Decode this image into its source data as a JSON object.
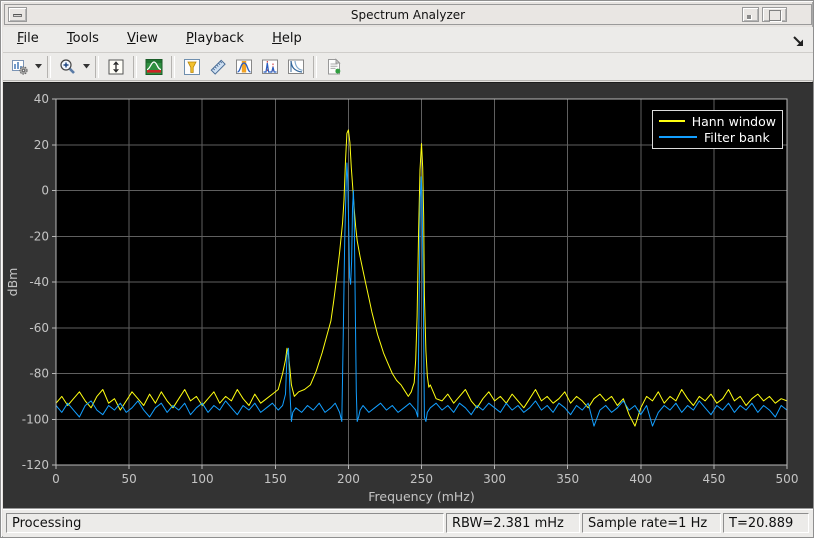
{
  "window": {
    "title": "Spectrum Analyzer"
  },
  "menu": {
    "items": [
      {
        "label": "File"
      },
      {
        "label": "Tools"
      },
      {
        "label": "View"
      },
      {
        "label": "Playback"
      },
      {
        "label": "Help"
      }
    ]
  },
  "toolbar": {
    "icons": [
      "configuration",
      "zoom-in",
      "autoscale-y",
      "spectrum-settings",
      "peak-finder",
      "cursor-measurements",
      "channel-measurements",
      "distortion-measurements",
      "spectral-mask",
      "generate-script"
    ]
  },
  "statusbar": {
    "state": "Processing",
    "rbw": "RBW=2.381 mHz",
    "sample_rate": "Sample rate=1 Hz",
    "time": "T=20.889"
  },
  "colors": {
    "trace_yellow": "#FFFF11",
    "trace_blue": "#139FFF",
    "plot_background": "#000000",
    "panel_background": "#333333",
    "grid": "#5f5f5f",
    "axis": "#b8b8b8",
    "tick_label": "#c4c4c4"
  },
  "chart_data": {
    "type": "line",
    "title": "",
    "xlabel": "Frequency (mHz)",
    "ylabel": "dBm",
    "xlim": [
      0,
      500
    ],
    "ylim": [
      -120,
      40
    ],
    "xticks": [
      0,
      50,
      100,
      150,
      200,
      250,
      300,
      350,
      400,
      450,
      500
    ],
    "yticks": [
      40,
      20,
      0,
      -20,
      -40,
      -60,
      -80,
      -100,
      -120
    ],
    "grid": true,
    "legend_position": "top-right",
    "series": [
      {
        "name": "Hann window",
        "color": "#FFFF11",
        "points": [
          [
            0,
            -93
          ],
          [
            4,
            -90
          ],
          [
            8,
            -94
          ],
          [
            12,
            -91
          ],
          [
            16,
            -88
          ],
          [
            20,
            -92
          ],
          [
            24,
            -95
          ],
          [
            28,
            -90
          ],
          [
            32,
            -87
          ],
          [
            36,
            -93
          ],
          [
            40,
            -91
          ],
          [
            44,
            -96
          ],
          [
            48,
            -92
          ],
          [
            52,
            -88
          ],
          [
            56,
            -91
          ],
          [
            60,
            -94
          ],
          [
            64,
            -89
          ],
          [
            68,
            -93
          ],
          [
            72,
            -88
          ],
          [
            76,
            -92
          ],
          [
            80,
            -95
          ],
          [
            84,
            -91
          ],
          [
            88,
            -87
          ],
          [
            92,
            -92
          ],
          [
            96,
            -90
          ],
          [
            100,
            -94
          ],
          [
            104,
            -91
          ],
          [
            108,
            -88
          ],
          [
            112,
            -93
          ],
          [
            116,
            -90
          ],
          [
            120,
            -92
          ],
          [
            124,
            -87
          ],
          [
            128,
            -91
          ],
          [
            132,
            -94
          ],
          [
            136,
            -89
          ],
          [
            140,
            -93
          ],
          [
            144,
            -91
          ],
          [
            148,
            -89
          ],
          [
            152,
            -87
          ],
          [
            155,
            -80
          ],
          [
            157,
            -74
          ],
          [
            158,
            -69
          ],
          [
            159,
            -72
          ],
          [
            160,
            -78
          ],
          [
            161,
            -85
          ],
          [
            163,
            -90
          ],
          [
            166,
            -88
          ],
          [
            170,
            -87
          ],
          [
            174,
            -85
          ],
          [
            178,
            -79
          ],
          [
            182,
            -71
          ],
          [
            185,
            -64
          ],
          [
            188,
            -57
          ],
          [
            190,
            -48
          ],
          [
            192,
            -38
          ],
          [
            194,
            -27
          ],
          [
            196,
            -14
          ],
          [
            197,
            -4
          ],
          [
            198,
            13
          ],
          [
            199,
            25
          ],
          [
            200,
            26.5
          ],
          [
            201,
            21
          ],
          [
            202,
            10
          ],
          [
            203,
            1
          ],
          [
            204,
            -8
          ],
          [
            205,
            -16
          ],
          [
            206,
            -22
          ],
          [
            208,
            -29
          ],
          [
            210,
            -35
          ],
          [
            212,
            -41
          ],
          [
            214,
            -47
          ],
          [
            216,
            -53
          ],
          [
            218,
            -58
          ],
          [
            220,
            -63
          ],
          [
            222,
            -67
          ],
          [
            224,
            -71
          ],
          [
            226,
            -74
          ],
          [
            228,
            -77
          ],
          [
            230,
            -80
          ],
          [
            233,
            -83
          ],
          [
            236,
            -85
          ],
          [
            239,
            -88
          ],
          [
            241,
            -90
          ],
          [
            243,
            -88
          ],
          [
            244,
            -86
          ],
          [
            245,
            -84
          ],
          [
            246,
            -74
          ],
          [
            247,
            -55
          ],
          [
            248,
            -18
          ],
          [
            249,
            9
          ],
          [
            250,
            20.5
          ],
          [
            250.8,
            10
          ],
          [
            251.5,
            -12
          ],
          [
            252,
            -46
          ],
          [
            253,
            -70
          ],
          [
            254,
            -81
          ],
          [
            255,
            -86
          ],
          [
            256,
            -85
          ],
          [
            258,
            -88
          ],
          [
            260,
            -91
          ],
          [
            264,
            -92
          ],
          [
            268,
            -89
          ],
          [
            272,
            -93
          ],
          [
            276,
            -90
          ],
          [
            280,
            -87
          ],
          [
            284,
            -92
          ],
          [
            288,
            -95
          ],
          [
            292,
            -91
          ],
          [
            296,
            -88
          ],
          [
            300,
            -92
          ],
          [
            304,
            -90
          ],
          [
            308,
            -93
          ],
          [
            312,
            -89
          ],
          [
            316,
            -92
          ],
          [
            320,
            -95
          ],
          [
            324,
            -91
          ],
          [
            328,
            -87
          ],
          [
            332,
            -92
          ],
          [
            336,
            -90
          ],
          [
            340,
            -93
          ],
          [
            344,
            -91
          ],
          [
            348,
            -88
          ],
          [
            352,
            -93
          ],
          [
            356,
            -90
          ],
          [
            360,
            -92
          ],
          [
            364,
            -95
          ],
          [
            368,
            -91
          ],
          [
            372,
            -89
          ],
          [
            376,
            -92
          ],
          [
            380,
            -90
          ],
          [
            384,
            -94
          ],
          [
            388,
            -91
          ],
          [
            392,
            -98
          ],
          [
            396,
            -103
          ],
          [
            400,
            -95
          ],
          [
            404,
            -90
          ],
          [
            408,
            -92
          ],
          [
            412,
            -88
          ],
          [
            416,
            -93
          ],
          [
            420,
            -90
          ],
          [
            424,
            -92
          ],
          [
            428,
            -87
          ],
          [
            432,
            -91
          ],
          [
            436,
            -94
          ],
          [
            440,
            -90
          ],
          [
            444,
            -92
          ],
          [
            448,
            -89
          ],
          [
            452,
            -93
          ],
          [
            456,
            -91
          ],
          [
            460,
            -87
          ],
          [
            464,
            -92
          ],
          [
            468,
            -90
          ],
          [
            472,
            -94
          ],
          [
            476,
            -91
          ],
          [
            480,
            -89
          ],
          [
            484,
            -92
          ],
          [
            488,
            -90
          ],
          [
            492,
            -93
          ],
          [
            496,
            -91
          ],
          [
            500,
            -92
          ]
        ]
      },
      {
        "name": "Filter bank",
        "color": "#139FFF",
        "points": [
          [
            0,
            -94
          ],
          [
            4,
            -97
          ],
          [
            8,
            -93
          ],
          [
            12,
            -96
          ],
          [
            16,
            -99
          ],
          [
            20,
            -94
          ],
          [
            24,
            -92
          ],
          [
            28,
            -96
          ],
          [
            32,
            -98
          ],
          [
            36,
            -94
          ],
          [
            40,
            -96
          ],
          [
            44,
            -93
          ],
          [
            48,
            -97
          ],
          [
            52,
            -95
          ],
          [
            56,
            -92
          ],
          [
            60,
            -96
          ],
          [
            64,
            -99
          ],
          [
            68,
            -95
          ],
          [
            72,
            -93
          ],
          [
            76,
            -97
          ],
          [
            80,
            -94
          ],
          [
            84,
            -96
          ],
          [
            88,
            -93
          ],
          [
            92,
            -98
          ],
          [
            96,
            -95
          ],
          [
            100,
            -93
          ],
          [
            104,
            -97
          ],
          [
            108,
            -94
          ],
          [
            112,
            -96
          ],
          [
            116,
            -92
          ],
          [
            120,
            -95
          ],
          [
            124,
            -98
          ],
          [
            128,
            -94
          ],
          [
            132,
            -96
          ],
          [
            136,
            -93
          ],
          [
            140,
            -97
          ],
          [
            144,
            -95
          ],
          [
            148,
            -93
          ],
          [
            152,
            -96
          ],
          [
            155,
            -94
          ],
          [
            157,
            -89
          ],
          [
            158,
            -72
          ],
          [
            159,
            -69
          ],
          [
            160,
            -88
          ],
          [
            161,
            -101
          ],
          [
            162,
            -97
          ],
          [
            164,
            -95
          ],
          [
            168,
            -97
          ],
          [
            172,
            -94
          ],
          [
            176,
            -96
          ],
          [
            180,
            -93
          ],
          [
            184,
            -97
          ],
          [
            188,
            -95
          ],
          [
            191,
            -93
          ],
          [
            194,
            -97
          ],
          [
            195.5,
            -101
          ],
          [
            196.5,
            -62
          ],
          [
            197.5,
            -22
          ],
          [
            198.5,
            4
          ],
          [
            199,
            12
          ],
          [
            199.6,
            4
          ],
          [
            200.2,
            -16
          ],
          [
            200.8,
            -38
          ],
          [
            201.5,
            -41
          ],
          [
            202.2,
            -31
          ],
          [
            202.8,
            -8
          ],
          [
            203.4,
            0
          ],
          [
            204,
            -12
          ],
          [
            204.7,
            -52
          ],
          [
            205.4,
            -88
          ],
          [
            206,
            -101
          ],
          [
            207,
            -99
          ],
          [
            208,
            -96
          ],
          [
            210,
            -94
          ],
          [
            214,
            -97
          ],
          [
            218,
            -95
          ],
          [
            222,
            -93
          ],
          [
            226,
            -96
          ],
          [
            230,
            -94
          ],
          [
            234,
            -97
          ],
          [
            238,
            -95
          ],
          [
            242,
            -93
          ],
          [
            246,
            -96
          ],
          [
            247.5,
            -99
          ],
          [
            248.5,
            -42
          ],
          [
            249.2,
            -3
          ],
          [
            249.8,
            6
          ],
          [
            250.4,
            -4
          ],
          [
            251.2,
            -46
          ],
          [
            252,
            -99
          ],
          [
            253,
            -101
          ],
          [
            254,
            -97
          ],
          [
            256,
            -95
          ],
          [
            260,
            -93
          ],
          [
            264,
            -96
          ],
          [
            268,
            -94
          ],
          [
            272,
            -97
          ],
          [
            276,
            -93
          ],
          [
            280,
            -95
          ],
          [
            284,
            -98
          ],
          [
            288,
            -94
          ],
          [
            292,
            -96
          ],
          [
            296,
            -93
          ],
          [
            300,
            -95
          ],
          [
            304,
            -97
          ],
          [
            308,
            -93
          ],
          [
            312,
            -96
          ],
          [
            316,
            -94
          ],
          [
            320,
            -97
          ],
          [
            324,
            -95
          ],
          [
            328,
            -92
          ],
          [
            332,
            -96
          ],
          [
            336,
            -94
          ],
          [
            340,
            -97
          ],
          [
            344,
            -93
          ],
          [
            348,
            -95
          ],
          [
            352,
            -98
          ],
          [
            356,
            -94
          ],
          [
            360,
            -96
          ],
          [
            364,
            -93
          ],
          [
            368,
            -103
          ],
          [
            372,
            -96
          ],
          [
            376,
            -94
          ],
          [
            380,
            -97
          ],
          [
            384,
            -95
          ],
          [
            388,
            -92
          ],
          [
            392,
            -96
          ],
          [
            396,
            -94
          ],
          [
            400,
            -98
          ],
          [
            404,
            -94
          ],
          [
            408,
            -103
          ],
          [
            412,
            -97
          ],
          [
            416,
            -94
          ],
          [
            420,
            -96
          ],
          [
            424,
            -93
          ],
          [
            428,
            -97
          ],
          [
            432,
            -94
          ],
          [
            436,
            -96
          ],
          [
            440,
            -92
          ],
          [
            444,
            -95
          ],
          [
            448,
            -98
          ],
          [
            452,
            -94
          ],
          [
            456,
            -96
          ],
          [
            460,
            -93
          ],
          [
            464,
            -97
          ],
          [
            468,
            -94
          ],
          [
            472,
            -96
          ],
          [
            476,
            -93
          ],
          [
            480,
            -97
          ],
          [
            484,
            -94
          ],
          [
            488,
            -96
          ],
          [
            492,
            -99
          ],
          [
            496,
            -94
          ],
          [
            500,
            -96
          ]
        ]
      }
    ]
  }
}
